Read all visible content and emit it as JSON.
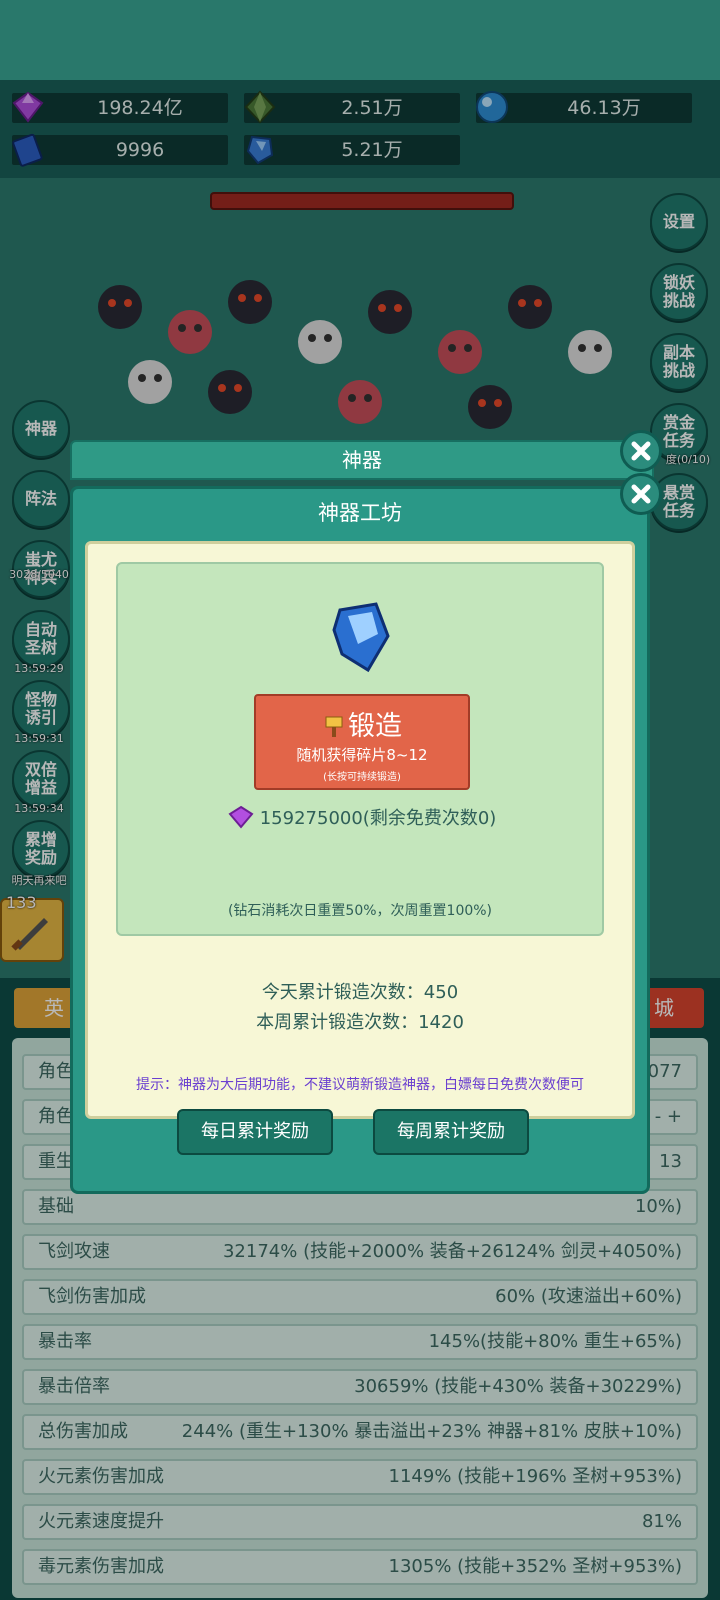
{
  "resources": [
    {
      "icon": "purple-gem-icon",
      "value": "198.24亿"
    },
    {
      "icon": "green-crystal-icon",
      "value": "2.51万"
    },
    {
      "icon": "blue-orb-icon",
      "value": "46.13万"
    },
    {
      "icon": "blue-book-icon",
      "value": "9996"
    },
    {
      "icon": "blue-shard-icon",
      "value": "5.21万"
    }
  ],
  "right_buttons": [
    "设置",
    "锁妖\n挑战",
    "副本\n挑战",
    "赏金\n任务",
    "悬赏\n任务"
  ],
  "right_sub": "度(0/10)",
  "left_buttons": [
    {
      "label": "神器",
      "sub": ""
    },
    {
      "label": "阵法",
      "sub": ""
    },
    {
      "label": "蚩尤\n神兵",
      "sub": "3028/5040"
    },
    {
      "label": "自动\n圣树",
      "sub": "13:59:29"
    },
    {
      "label": "怪物\n诱引",
      "sub": "13:59:31"
    },
    {
      "label": "双倍\n增益",
      "sub": "13:59:34"
    },
    {
      "label": "累增\n奖励",
      "sub": "明天再来吧"
    }
  ],
  "level_text": "133",
  "bg_tab_left": "英",
  "bg_tab_right": "城",
  "stats": [
    {
      "label": "角色",
      "value": "077"
    },
    {
      "label": "角色",
      "value": "- +"
    },
    {
      "label": "重生",
      "value": "13"
    },
    {
      "label": "基础",
      "value": "10%)"
    },
    {
      "label": "飞剑攻速",
      "value": "32174% (技能+2000% 装备+26124% 剑灵+4050%)"
    },
    {
      "label": "飞剑伤害加成",
      "value": "60% (攻速溢出+60%)"
    },
    {
      "label": "暴击率",
      "value": "145%(技能+80% 重生+65%)"
    },
    {
      "label": "暴击倍率",
      "value": "30659% (技能+430% 装备+30229%)"
    },
    {
      "label": "总伤害加成",
      "value": "244% (重生+130% 暴击溢出+23% 神器+81% 皮肤+10%)"
    },
    {
      "label": "火元素伤害加成",
      "value": "1149% (技能+196% 圣树+953%)"
    },
    {
      "label": "火元素速度提升",
      "value": "81%"
    },
    {
      "label": "毒元素伤害加成",
      "value": "1305% (技能+352% 圣树+953%)"
    }
  ],
  "panel": {
    "back_title": "神器",
    "title": "神器工坊",
    "forge_label": "锻造",
    "forge_desc": "随机获得碎片8~12",
    "forge_hint": "(长按可持续锻造)",
    "cost": "159275000(剩余免费次数0)",
    "reset_note": "(钻石消耗次日重置50%，次周重置100%)",
    "today_count": "今天累计锻造次数：450",
    "week_count": "本周累计锻造次数：1420",
    "tip": "提示：神器为大后期功能，不建议萌新锻造神器，白嫖每日免费次数便可",
    "daily_btn": "每日累计奖励",
    "weekly_btn": "每周累计奖励"
  },
  "colors": {
    "accent": "#2a9887",
    "forge": "#e26549",
    "tip": "#6a3fd0",
    "gem": "#b24fe0"
  }
}
